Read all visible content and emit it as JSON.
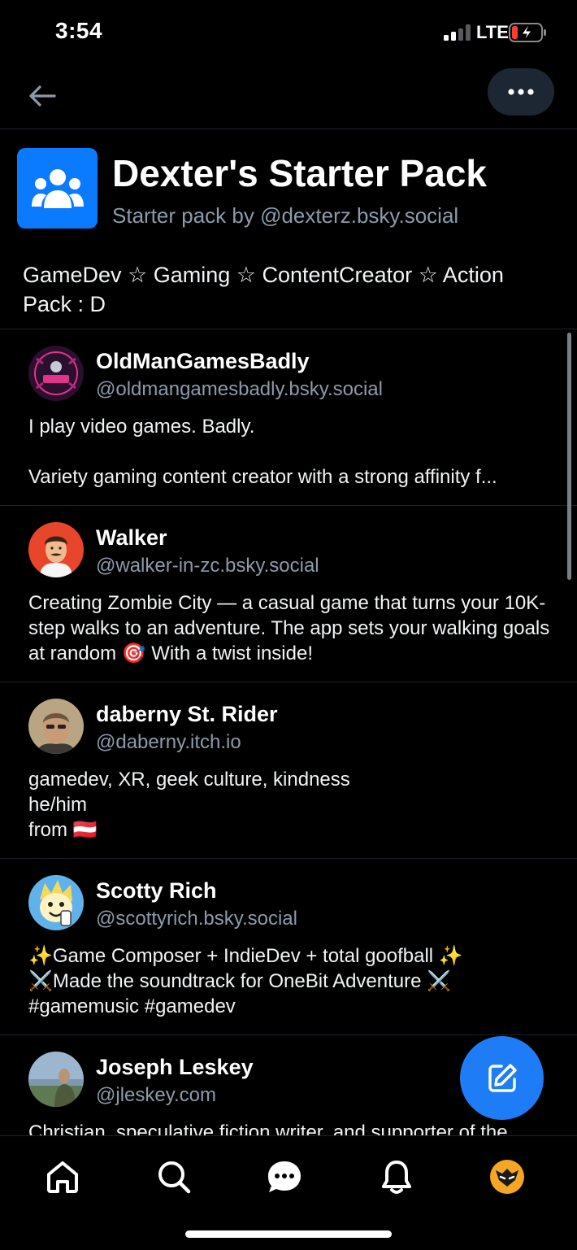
{
  "status_bar": {
    "time": "3:54",
    "network": "LTE"
  },
  "header": {
    "back_icon": "arrow-left-icon",
    "more_icon": "ellipsis-icon"
  },
  "pack": {
    "title": "Dexter's Starter Pack",
    "subtitle": "Starter pack by @dexterz.bsky.social",
    "description": "GameDev ☆ Gaming ☆ ContentCreator ☆ Action Pack : D",
    "icon": "people-group-icon",
    "icon_color": "#0a7aff"
  },
  "profiles": [
    {
      "name": "OldManGamesBadly",
      "handle": "@oldmangamesbadly.bsky.social",
      "bio": "I play video games. Badly.\n\nVariety gaming content creator with a strong affinity f..."
    },
    {
      "name": "Walker",
      "handle": "@walker-in-zc.bsky.social",
      "bio": "Creating Zombie City — a casual game that turns your 10K-step walks to an adventure. The app sets your walking goals at random 🎯 With a twist inside!"
    },
    {
      "name": "daberny St. Rider",
      "handle": "@daberny.itch.io",
      "bio": "gamedev, XR, geek culture, kindness\nhe/him\nfrom 🇦🇹"
    },
    {
      "name": "Scotty Rich",
      "handle": "@scottyrich.bsky.social",
      "bio": "✨Game Composer + IndieDev + total goofball ✨\n⚔️Made the soundtrack for OneBit Adventure ⚔️\n#gamemusic #gamedev"
    },
    {
      "name": "Joseph Leskey",
      "handle": "@jleskey.com",
      "bio": "Christian, speculative fiction writer, and supporter of the"
    }
  ],
  "fab": {
    "icon": "compose-icon",
    "color": "#1f7cf7"
  },
  "bottom_nav": [
    "home-icon",
    "search-icon",
    "chat-icon",
    "bell-icon",
    "profile-avatar"
  ]
}
